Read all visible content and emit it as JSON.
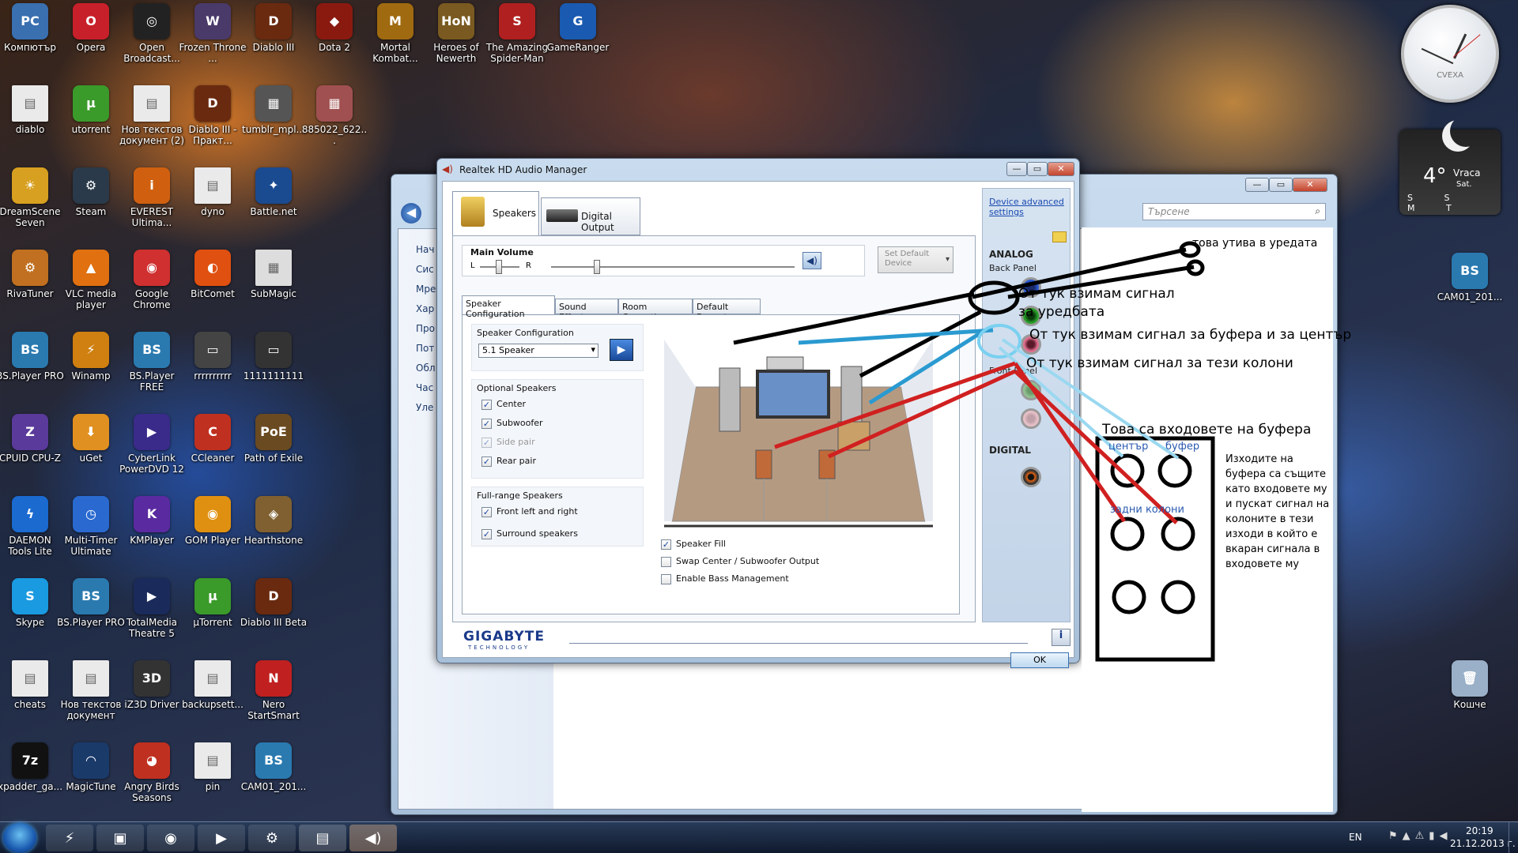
{
  "desktop": {
    "icons": [
      {
        "label": "Компютър",
        "bg": "#3a6fb0",
        "g": "PC"
      },
      {
        "label": "Opera",
        "bg": "#c8202a",
        "g": "O"
      },
      {
        "label": "Open Broadcast...",
        "bg": "#222",
        "g": "◎"
      },
      {
        "label": "Frozen Throne ...",
        "bg": "#4a3a6a",
        "g": "W"
      },
      {
        "label": "Diablo III",
        "bg": "#6a2a10",
        "g": "D"
      },
      {
        "label": "Dota 2",
        "bg": "#8a1a10",
        "g": "◆"
      },
      {
        "label": "Mortal Kombat...",
        "bg": "#a06a10",
        "g": "M"
      },
      {
        "label": "Heroes of Newerth",
        "bg": "#7a5a20",
        "g": "HoN"
      },
      {
        "label": "The Amazing Spider-Man",
        "bg": "#b02020",
        "g": "S"
      },
      {
        "label": "GameRanger",
        "bg": "#1a5ab0",
        "g": "G"
      },
      {
        "label": "diablo",
        "bg": "#eaeaea",
        "g": "▤"
      },
      {
        "label": "utorrent",
        "bg": "#3a9a2a",
        "g": "µ"
      },
      {
        "label": "Нов текстов документ (2)",
        "bg": "#eaeaea",
        "g": "▤"
      },
      {
        "label": "Diablo III - Практ...",
        "bg": "#6a2a10",
        "g": "D"
      },
      {
        "label": "tumblr_mpl...",
        "bg": "#555",
        "g": "▦"
      },
      {
        "label": "885022_622...",
        "bg": "#a05050",
        "g": "▦"
      },
      {
        "label": "DreamScene Seven",
        "bg": "#d8a020",
        "g": "☀"
      },
      {
        "label": "Steam",
        "bg": "#2a3a4a",
        "g": "⚙"
      },
      {
        "label": "EVEREST Ultima...",
        "bg": "#d06010",
        "g": "i"
      },
      {
        "label": "dyno",
        "bg": "#eaeaea",
        "g": "▤"
      },
      {
        "label": "Battle.net",
        "bg": "#1a4a90",
        "g": "✦"
      },
      {
        "label": "RivaTuner",
        "bg": "#c07020",
        "g": "⚙"
      },
      {
        "label": "VLC media player",
        "bg": "#e07010",
        "g": "▲"
      },
      {
        "label": "Google Chrome",
        "bg": "#d03030",
        "g": "◉"
      },
      {
        "label": "BitComet",
        "bg": "#e05010",
        "g": "◐"
      },
      {
        "label": "SubMagic",
        "bg": "#ddd",
        "g": "▦"
      },
      {
        "label": "BS.Player PRO",
        "bg": "#2a7ab0",
        "g": "BS"
      },
      {
        "label": "Winamp",
        "bg": "#d08010",
        "g": "⚡"
      },
      {
        "label": "BS.Player FREE",
        "bg": "#2a7ab0",
        "g": "BS"
      },
      {
        "label": "rrrrrrrrrr",
        "bg": "#444",
        "g": "▭"
      },
      {
        "label": "1111111111",
        "bg": "#333",
        "g": "▭"
      },
      {
        "label": "CPUID CPU-Z",
        "bg": "#5a3a9a",
        "g": "Z"
      },
      {
        "label": "uGet",
        "bg": "#e09020",
        "g": "⬇"
      },
      {
        "label": "CyberLink PowerDVD 12",
        "bg": "#3a2a8a",
        "g": "▶"
      },
      {
        "label": "CCleaner",
        "bg": "#c03020",
        "g": "C"
      },
      {
        "label": "Path of Exile",
        "bg": "#6a4a20",
        "g": "PoE"
      },
      {
        "label": "DAEMON Tools Lite",
        "bg": "#1a6ad0",
        "g": "ϟ"
      },
      {
        "label": "Multi-Timer Ultimate",
        "bg": "#2a6ad0",
        "g": "◷"
      },
      {
        "label": "KMPlayer",
        "bg": "#5a2aa0",
        "g": "K"
      },
      {
        "label": "GOM Player",
        "bg": "#e09010",
        "g": "◉"
      },
      {
        "label": "Hearthstone",
        "bg": "#806030",
        "g": "◈"
      },
      {
        "label": "Skype",
        "bg": "#1a9ae0",
        "g": "S"
      },
      {
        "label": "BS.Player PRO",
        "bg": "#2a7ab0",
        "g": "BS"
      },
      {
        "label": "TotalMedia Theatre 5",
        "bg": "#1a2a5a",
        "g": "▶"
      },
      {
        "label": "µTorrent",
        "bg": "#3a9a2a",
        "g": "µ"
      },
      {
        "label": "Diablo III Beta",
        "bg": "#6a2a10",
        "g": "D"
      },
      {
        "label": "cheats",
        "bg": "#eaeaea",
        "g": "▤"
      },
      {
        "label": "Нов текстов документ",
        "bg": "#eaeaea",
        "g": "▤"
      },
      {
        "label": "iZ3D Driver",
        "bg": "#333",
        "g": "3D"
      },
      {
        "label": "backupsett...",
        "bg": "#eaeaea",
        "g": "▤"
      },
      {
        "label": "Nero StartSmart",
        "bg": "#c02020",
        "g": "N"
      },
      {
        "label": "xpadder_ga...",
        "bg": "#111",
        "g": "7z"
      },
      {
        "label": "MagicTune",
        "bg": "#1a3a6a",
        "g": "◠"
      },
      {
        "label": "Angry Birds Seasons",
        "bg": "#c03020",
        "g": "◕"
      },
      {
        "label": "pin",
        "bg": "#eaeaea",
        "g": "▤"
      },
      {
        "label": "CAM01_201...",
        "bg": "#2a7ab0",
        "g": "BS"
      }
    ],
    "right_icons": [
      {
        "label": "CAM01_201...",
        "bg": "#2a7ab0",
        "g": "BS"
      },
      {
        "label": "Кошче",
        "bg": "#9ab0c8",
        "g": "🗑"
      }
    ]
  },
  "clock_gadget": {
    "brand": "CVEXA"
  },
  "weather_gadget": {
    "temp": "4°",
    "city": "Vraca",
    "day": "Sat.",
    "days": "S S M T"
  },
  "bg_window": {
    "search_placeholder": "Търсене",
    "sidebar": [
      "Нач",
      "Сис",
      "Мре",
      "Хар",
      "Про",
      "Пот",
      "Обл",
      "Час",
      "Уле"
    ]
  },
  "realtek": {
    "title": "Realtek HD Audio Manager",
    "tab_speakers": "Speakers",
    "tab_digital": "Digital Output",
    "device_advanced": "Device advanced settings",
    "analog": "ANALOG",
    "back_panel": "Back Panel",
    "front_panel": "Front Panel",
    "digital": "DIGITAL",
    "main_volume": "Main Volume",
    "l": "L",
    "r": "R",
    "set_default": "Set Default Device",
    "subtabs": [
      "Speaker Configuration",
      "Sound Effects",
      "Room Correction",
      "Default Format"
    ],
    "speaker_config_label": "Speaker Configuration",
    "speaker_config_value": "5.1 Speaker",
    "optional_speakers": "Optional Speakers",
    "opt_center": "Center",
    "opt_subwoofer": "Subwoofer",
    "opt_side": "Side pair",
    "opt_rear": "Rear pair",
    "fullrange": "Full-range Speakers",
    "fr_front": "Front left and right",
    "fr_surround": "Surround speakers",
    "speaker_fill": "Speaker Fill",
    "swap": "Swap Center / Subwoofer Output",
    "bass": "Enable Bass Management",
    "brand": "GIGABYTE",
    "brand_sub": "TECHNOLOGY",
    "ok": "OK"
  },
  "annotations": {
    "a1": "това утива в уредата",
    "a2a": "От тук взимам сигнал",
    "a2b": "за уредбата",
    "a3": "От тук взимам сигнал за буфера и за център",
    "a4": "От тук взимам сигнал за тези колони",
    "a5": "Това са входовете на буфера",
    "centr": "център",
    "bufer": "буфер",
    "zadni": "задни колони",
    "note": "Изходите на буфера са същите като входовете му и пускат сигнал на колоните в тези изходи в който е вкаран сигнала в входовете му"
  },
  "taskbar": {
    "lang": "EN",
    "time": "20:19",
    "date": "21.12.2013 г."
  }
}
